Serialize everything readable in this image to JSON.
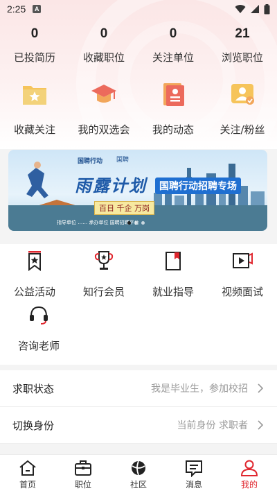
{
  "status_bar": {
    "time": "2:25",
    "badge": "A"
  },
  "stats": [
    {
      "value": "0",
      "label": "已投简历"
    },
    {
      "value": "0",
      "label": "收藏职位"
    },
    {
      "value": "0",
      "label": "关注单位"
    },
    {
      "value": "21",
      "label": "浏览职位"
    }
  ],
  "quick_actions": [
    {
      "label": "收藏关注",
      "icon": "star-folder-icon"
    },
    {
      "label": "我的双选会",
      "icon": "graduation-cap-icon"
    },
    {
      "label": "我的动态",
      "icon": "document-icon"
    },
    {
      "label": "关注/粉丝",
      "icon": "followers-icon"
    }
  ],
  "banner": {
    "brand_left": "国聘行动",
    "brand_right": "国聘",
    "slogan": "雨露计划",
    "subtitle": "国聘行动招聘专场",
    "badge": "百日 千企 万岗",
    "footer": "指导单位 …… 承办单位 国聘招聘平台"
  },
  "services": [
    {
      "label": "公益活动",
      "icon": "bookmark-star-icon"
    },
    {
      "label": "知行会员",
      "icon": "trophy-icon"
    },
    {
      "label": "就业指导",
      "icon": "book-icon"
    },
    {
      "label": "视频面试",
      "icon": "video-play-icon"
    },
    {
      "label": "咨询老师",
      "icon": "headset-icon"
    }
  ],
  "settings": [
    {
      "key": "求职状态",
      "value": "我是毕业生，参加校招"
    },
    {
      "key": "切换身份",
      "value": "当前身份 求职者"
    }
  ],
  "tabs": [
    {
      "label": "首页",
      "icon": "home-icon",
      "active": false
    },
    {
      "label": "职位",
      "icon": "briefcase-icon",
      "active": false
    },
    {
      "label": "社区",
      "icon": "community-icon",
      "active": false
    },
    {
      "label": "消息",
      "icon": "message-icon",
      "active": false
    },
    {
      "label": "我的",
      "icon": "profile-icon",
      "active": true
    }
  ],
  "colors": {
    "accent": "#e0262e",
    "icon_orange": "#f2a65a",
    "icon_red": "#ec6a5c"
  }
}
